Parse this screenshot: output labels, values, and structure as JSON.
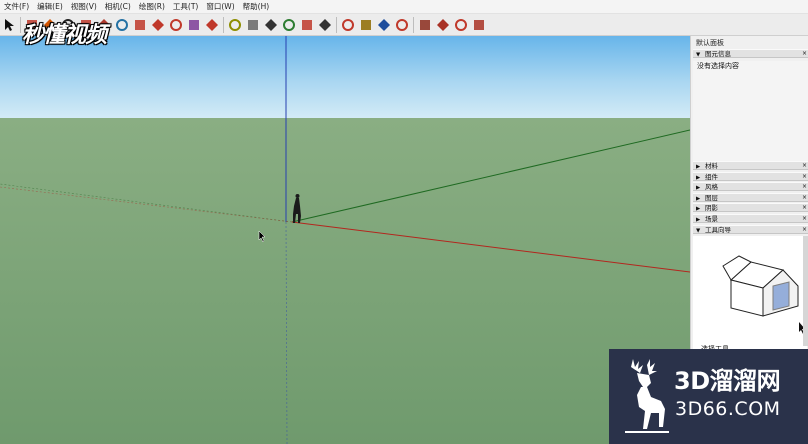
{
  "menu": {
    "items": [
      "文件(F)",
      "编辑(E)",
      "视图(V)",
      "相机(C)",
      "绘图(R)",
      "工具(T)",
      "窗口(W)",
      "帮助(H)"
    ]
  },
  "toolbar": {
    "buttons": [
      {
        "name": "select-tool-icon"
      },
      {
        "name": "eraser-tool-icon"
      },
      {
        "name": "paint-bucket-tool-icon"
      },
      {
        "name": "line-tool-icon"
      },
      {
        "name": "arc-tool-icon"
      },
      {
        "name": "rectangle-tool-icon"
      },
      {
        "name": "circle-tool-icon"
      },
      {
        "name": "push-pull-tool-icon"
      },
      {
        "name": "move-tool-icon"
      },
      {
        "name": "rotate-tool-icon"
      },
      {
        "name": "scale-tool-icon"
      },
      {
        "name": "offset-tool-icon"
      },
      {
        "name": "tape-measure-tool-icon"
      },
      {
        "name": "dimension-tool-icon"
      },
      {
        "name": "text-tool-icon"
      },
      {
        "name": "protractor-tool-icon"
      },
      {
        "name": "axes-tool-icon"
      },
      {
        "name": "3d-text-tool-icon"
      },
      {
        "name": "orbit-tool-icon"
      },
      {
        "name": "pan-tool-icon"
      },
      {
        "name": "zoom-tool-icon"
      },
      {
        "name": "zoom-extents-tool-icon"
      },
      {
        "name": "warehouse-icon"
      },
      {
        "name": "extension-warehouse-icon"
      },
      {
        "name": "share-model-icon"
      },
      {
        "name": "ruby-console-icon"
      }
    ]
  },
  "watermark": {
    "logo_text": "秒懂视频"
  },
  "viewport": {
    "sky_color": "#bfe2f7",
    "ground_color": "#7ea27a"
  },
  "panel": {
    "tray_title": "默认面板",
    "entity_info": {
      "header": "图元信息",
      "status": "没有选择内容"
    },
    "sections": [
      "材料",
      "组件",
      "风格",
      "图层",
      "阴影",
      "场景"
    ],
    "instructor_header": "工具向导",
    "instructor_caption": "选择工具"
  },
  "ad": {
    "brand": "3D溜溜网",
    "domain": "3D66.COM"
  }
}
